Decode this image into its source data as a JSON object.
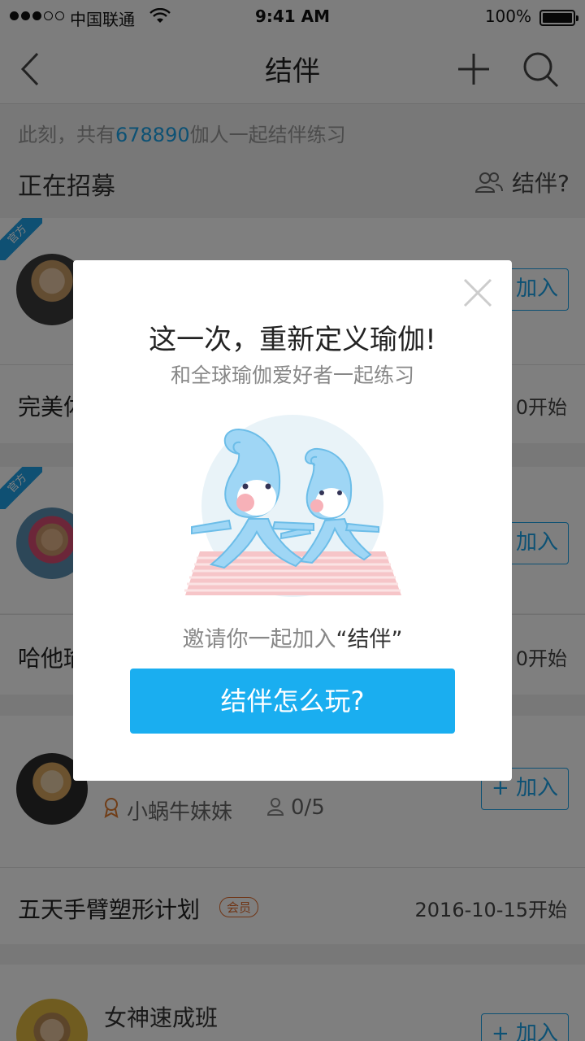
{
  "status_bar": {
    "carrier": "中国联通",
    "time": "9:41 AM",
    "battery": "100%"
  },
  "nav": {
    "title": "结伴"
  },
  "header": {
    "summary_prefix": "此刻，共有",
    "summary_count": "678890",
    "summary_suffix": "伽人一起结伴练习",
    "section_title": "正在招募",
    "partner_link": "结伴?"
  },
  "list": {
    "official_tag": "官方",
    "join_label": "+ 加入",
    "groups": [
      {
        "tail_visible": true
      },
      {
        "title": "完美体",
        "date": "0开始"
      },
      {
        "tail_visible": true
      },
      {
        "title": "哈他瑜",
        "date": "0开始"
      },
      {
        "leader": "小蜗牛妹妹",
        "members": "0/5"
      },
      {
        "title": "五天手臂塑形计划",
        "badge": "会员",
        "date": "2016-10-15开始"
      },
      {
        "name": "女神速成班"
      }
    ]
  },
  "modal": {
    "headline": "这一次，重新定义瑜伽!",
    "subline": "和全球瑜伽爱好者一起练习",
    "invite_prefix": "邀请你一起加入",
    "invite_name": "“结伴”",
    "cta": "结伴怎么玩?"
  },
  "colors": {
    "accent": "#1aa3e8",
    "cta": "#1aaef0",
    "badge": "#e06a2b",
    "overlay": "rgba(0,0,0,0.5)"
  },
  "icons": [
    "back-icon",
    "plus-icon",
    "search-icon",
    "people-icon",
    "close-icon",
    "medal-icon",
    "person-icon"
  ]
}
